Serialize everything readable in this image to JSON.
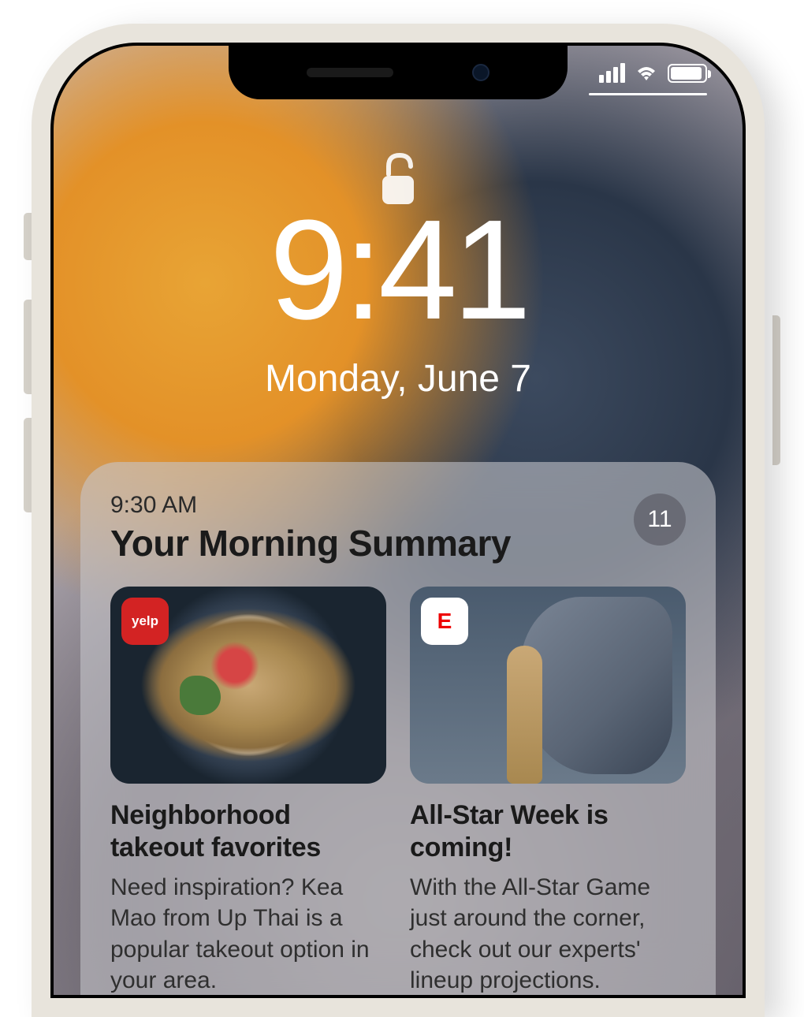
{
  "lockscreen": {
    "time": "9:41",
    "date": "Monday, June 7",
    "unlocked": true
  },
  "status_bar": {
    "signal_bars": 4,
    "wifi": true,
    "battery_full": true
  },
  "summary": {
    "time": "9:30 AM",
    "title": "Your Morning Summary",
    "count": "11",
    "cards": [
      {
        "app": "Yelp",
        "app_label": "yelp",
        "title": "Neighborhood takeout favorites",
        "body": "Need inspiration? Kea Mao from Up Thai is a popular takeout option in your area."
      },
      {
        "app": "ESPN",
        "app_label": "E",
        "title": "All-Star Week is coming!",
        "body": "With the All-Star Game just around the corner, check out our experts' lineup projections."
      }
    ]
  }
}
